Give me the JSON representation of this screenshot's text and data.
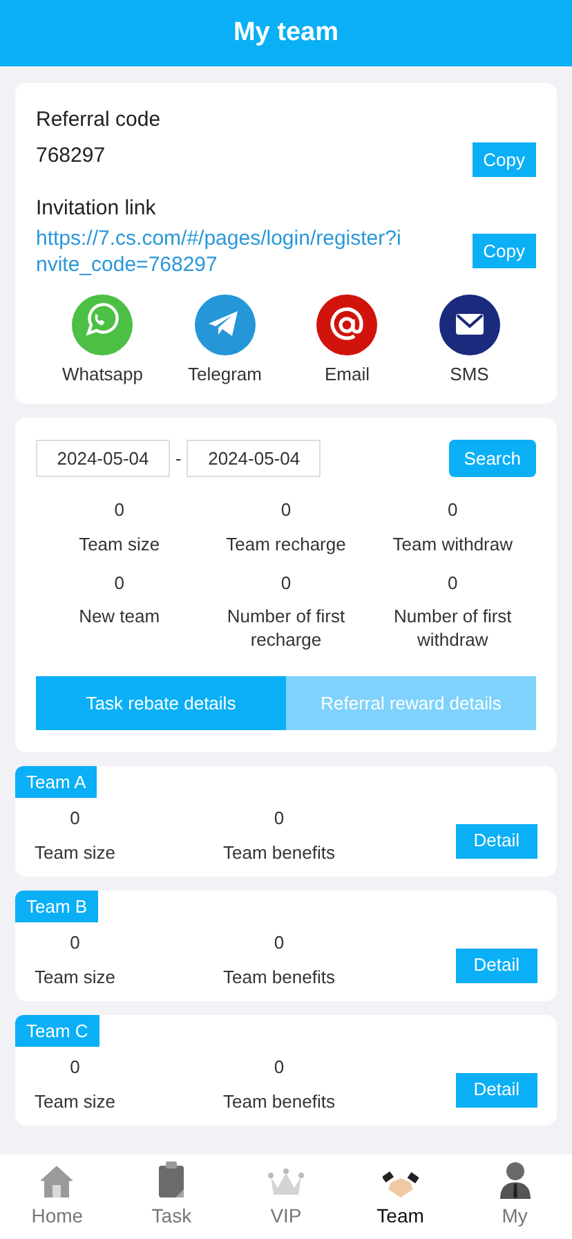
{
  "header": {
    "title": "My team"
  },
  "referral": {
    "label": "Referral code",
    "code": "768297",
    "copy_button": "Copy"
  },
  "invitation": {
    "label": "Invitation link",
    "link": "https://7.cs.com/#/pages/login/register?invite_code=768297",
    "copy_button": "Copy"
  },
  "share": [
    {
      "kind": "whatsapp",
      "label": "Whatsapp",
      "color": "#4cbf45"
    },
    {
      "kind": "telegram",
      "label": "Telegram",
      "color": "#2596d8"
    },
    {
      "kind": "email",
      "label": "Email",
      "color": "#d0140c"
    },
    {
      "kind": "sms",
      "label": "SMS",
      "color": "#1a2a7c"
    }
  ],
  "filter": {
    "start_date": "2024-05-04",
    "separator": "-",
    "end_date": "2024-05-04",
    "search_button": "Search"
  },
  "stats": [
    {
      "value": "0",
      "label": "Team size"
    },
    {
      "value": "0",
      "label": "Team recharge"
    },
    {
      "value": "0",
      "label": "Team withdraw"
    },
    {
      "value": "0",
      "label": "New team"
    },
    {
      "value": "0",
      "label": "Number of first recharge"
    },
    {
      "value": "0",
      "label": "Number of first withdraw"
    }
  ],
  "tabs": [
    {
      "label": "Task rebate details",
      "selected": true
    },
    {
      "label": "Referral reward details",
      "selected": false
    }
  ],
  "teams": [
    {
      "name": "Team A",
      "size": "0",
      "size_label": "Team size",
      "benefits": "0",
      "benefits_label": "Team benefits",
      "button": "Detail"
    },
    {
      "name": "Team B",
      "size": "0",
      "size_label": "Team size",
      "benefits": "0",
      "benefits_label": "Team benefits",
      "button": "Detail"
    },
    {
      "name": "Team C",
      "size": "0",
      "size_label": "Team size",
      "benefits": "0",
      "benefits_label": "Team benefits",
      "button": "Detail"
    }
  ],
  "nav": [
    {
      "kind": "home",
      "label": "Home",
      "selected": false
    },
    {
      "kind": "task",
      "label": "Task",
      "selected": false
    },
    {
      "kind": "vip",
      "label": "VIP",
      "selected": false
    },
    {
      "kind": "team",
      "label": "Team",
      "selected": true
    },
    {
      "kind": "my",
      "label": "My",
      "selected": false
    }
  ]
}
